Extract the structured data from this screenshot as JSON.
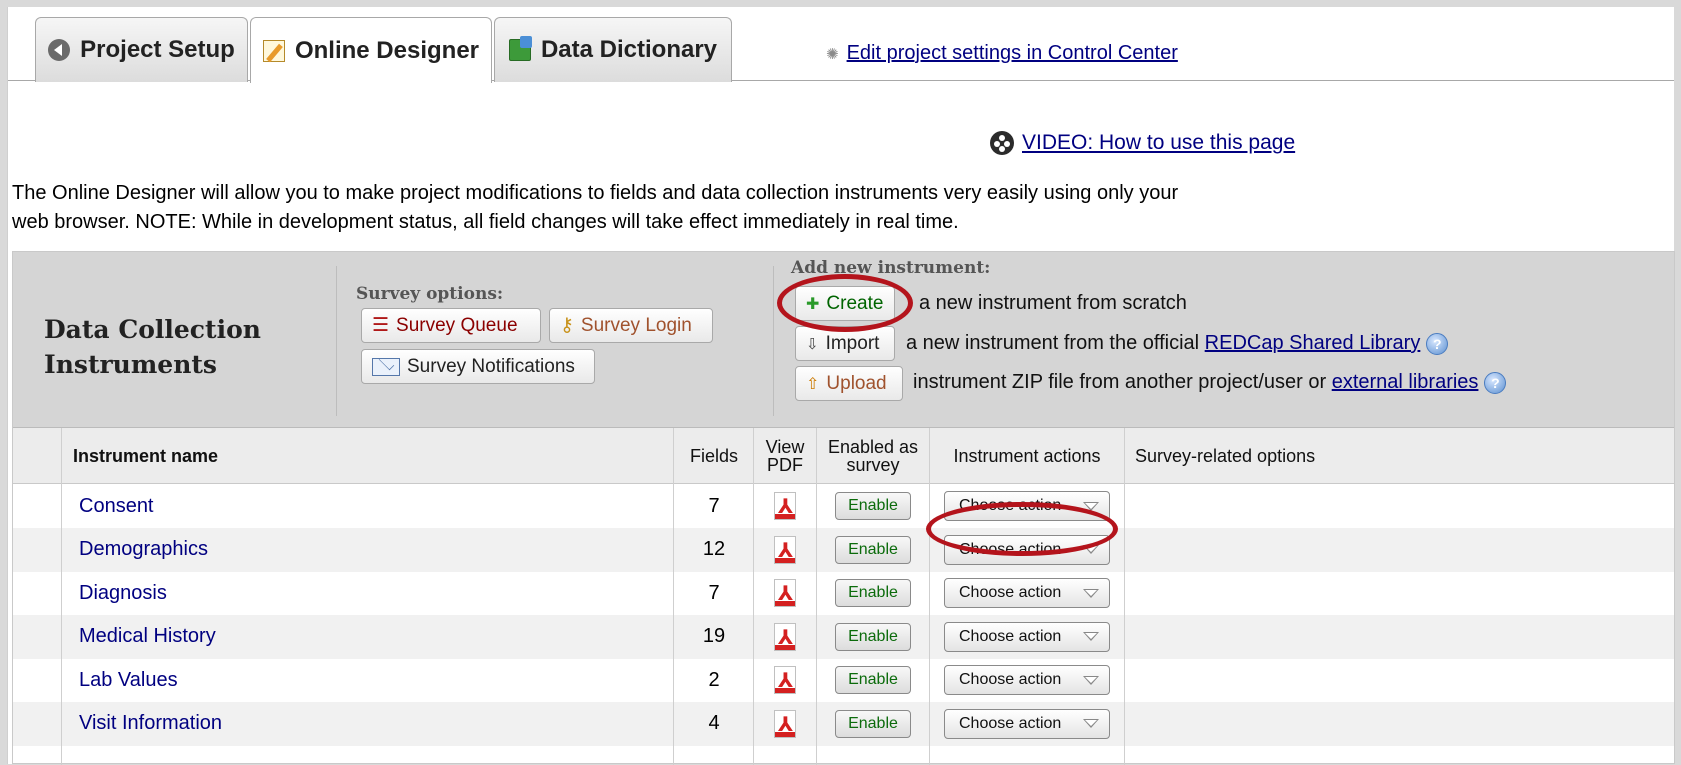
{
  "tabs": [
    {
      "label": "Project Setup",
      "icon": "back-arrow-icon"
    },
    {
      "label": "Online Designer",
      "icon": "pencil-edit-icon"
    },
    {
      "label": "Data Dictionary",
      "icon": "data-dictionary-icon"
    }
  ],
  "settings_link": "Edit project settings in Control Center",
  "video_link": "VIDEO: How to use this page",
  "intro_line1": "The Online Designer will allow you to make project modifications to fields and data collection instruments very easily using only your",
  "intro_line2": "web browser. NOTE: While in development status, all field changes will take effect immediately in real time.",
  "panel": {
    "title_line1": "Data Collection",
    "title_line2": "Instruments",
    "survey_options_label": "Survey options:",
    "survey_queue": "Survey Queue",
    "survey_login": "Survey Login",
    "survey_notifications": "Survey Notifications",
    "add_label": "Add new instrument:",
    "create": "Create",
    "create_text": "a new instrument from scratch",
    "import": "Import",
    "import_text": "a new instrument from the official",
    "shared_library": "REDCap Shared Library",
    "upload": "Upload",
    "upload_text": "instrument ZIP file from another project/user or",
    "external_libraries": "external libraries"
  },
  "columns": {
    "name": "Instrument name",
    "fields": "Fields",
    "view_pdf": "View PDF",
    "enabled_as_survey": "Enabled as survey",
    "actions": "Instrument actions",
    "survey_options": "Survey-related options"
  },
  "enable_label": "Enable",
  "choose_action_label": "Choose action",
  "instruments": [
    {
      "name": "Consent",
      "fields": "7"
    },
    {
      "name": "Demographics",
      "fields": "12"
    },
    {
      "name": "Diagnosis",
      "fields": "7"
    },
    {
      "name": "Medical History",
      "fields": "19"
    },
    {
      "name": "Lab Values",
      "fields": "2"
    },
    {
      "name": "Visit Information",
      "fields": "4"
    }
  ],
  "highlight_color": "#b4141c"
}
